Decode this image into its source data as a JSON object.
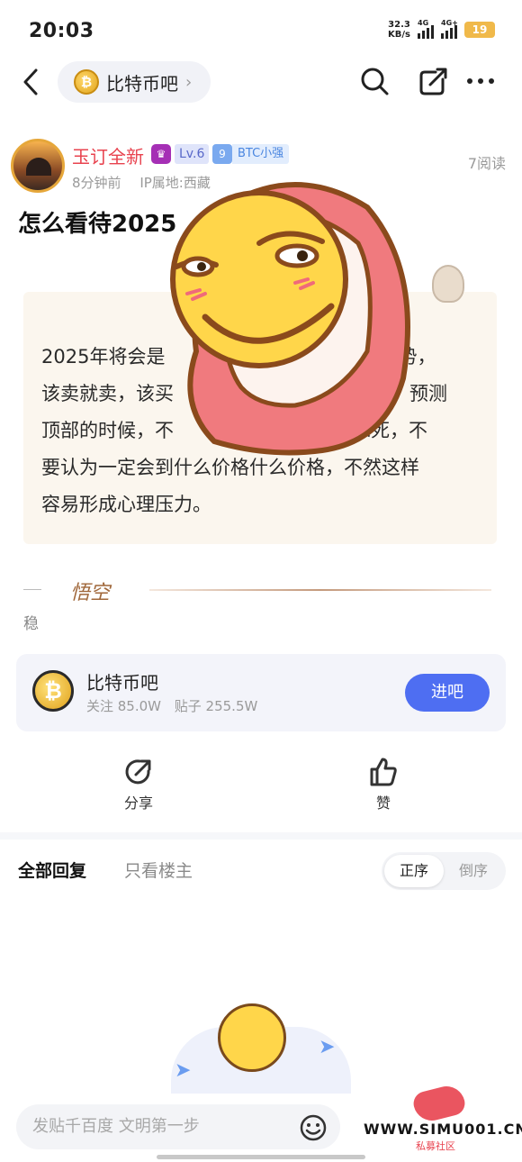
{
  "status_bar": {
    "time": "20:03",
    "net_speed_value": "32.3",
    "net_speed_unit": "KB/s",
    "signal_1_label": "4G",
    "signal_2_label": "4G+",
    "battery": "19"
  },
  "nav": {
    "forum_name": "比特币吧",
    "forum_chevron": "›",
    "icons": [
      "back-icon",
      "search-icon",
      "share-edit-icon",
      "more-icon"
    ]
  },
  "post": {
    "author_name": "玉订全新",
    "level": "Lv.6",
    "fan_level": "9",
    "fan_badge": "BTC小强",
    "time_ago": "8分钟前",
    "ip_location": "IP属地:西藏",
    "read_count": "7阅读",
    "title": "怎么看待2025",
    "body_lines": [
      "2025年将会是",
      "趋势，",
      "该卖就卖，该买",
      "预测",
      "顶部的时候，不",
      "求死，不",
      "要认为一定会到什么价格什么价格，不然这样",
      "容易形成心理压力。"
    ],
    "signature_mark": "悟空",
    "tail_text": "稳"
  },
  "forum_card": {
    "name": "比特币吧",
    "followers": "关注 85.0W",
    "posts": "贴子 255.5W",
    "join_label": "进吧",
    "coin_symbol": "₿"
  },
  "actions": {
    "share_label": "分享",
    "like_label": "赞"
  },
  "replies": {
    "tab_all": "全部回复",
    "tab_op_only": "只看楼主",
    "sort_asc": "正序",
    "sort_desc": "倒序"
  },
  "composer": {
    "placeholder": "发贴千百度 文明第一步"
  },
  "watermark": {
    "url": "WWW.SIMU001.CN",
    "subtitle": "私募社区"
  },
  "colors": {
    "accent_blue": "#4e6ef2",
    "author_red": "#e8434f",
    "card_bg": "#fbf6ee"
  }
}
